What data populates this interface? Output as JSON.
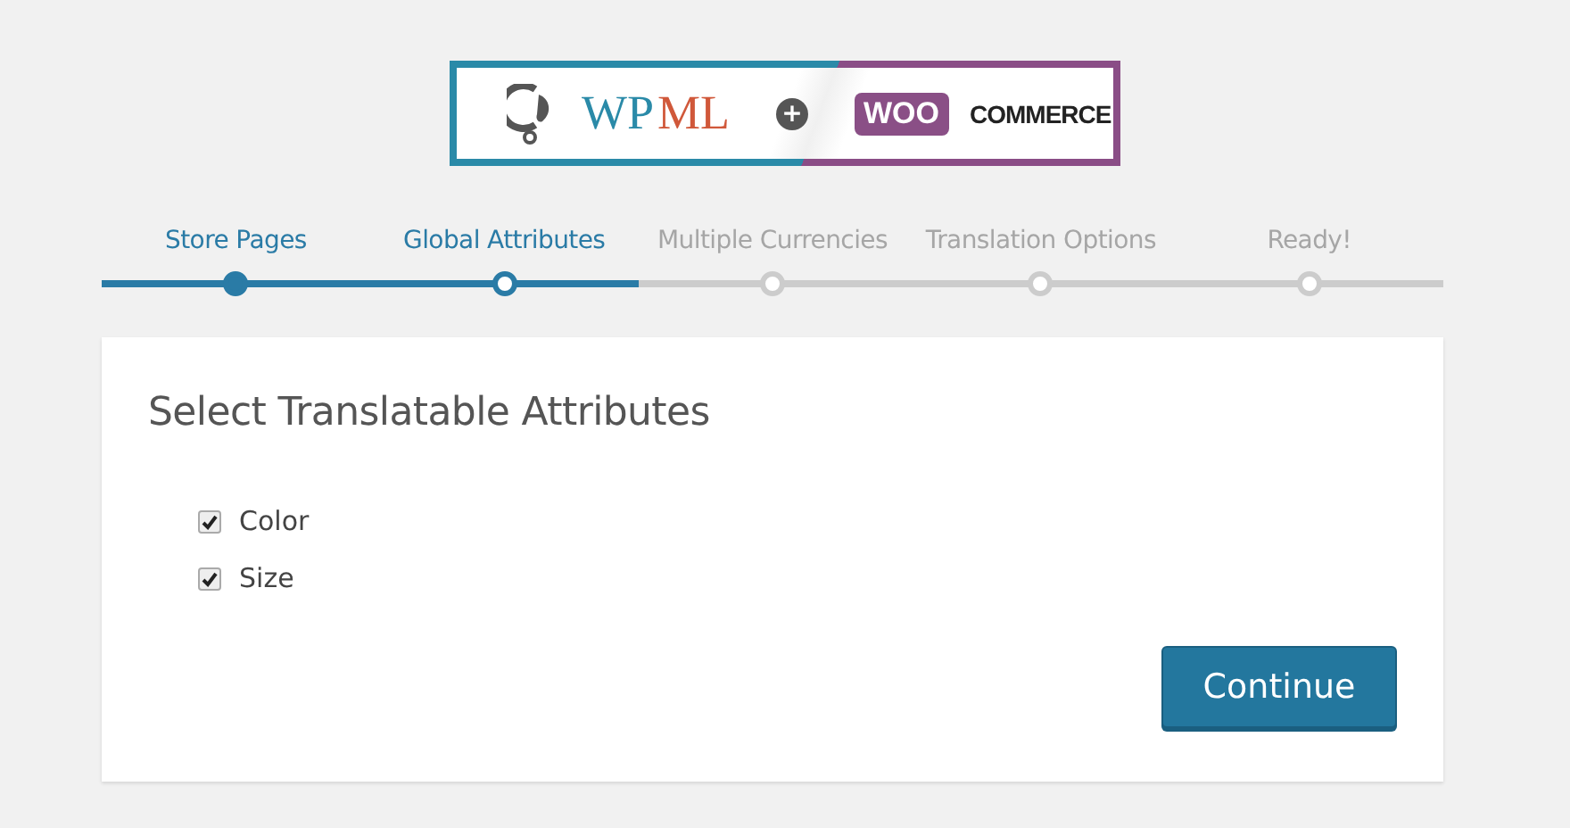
{
  "logo": {
    "left_text_1": "WP",
    "left_text_2": "ML",
    "plus": "+",
    "right_badge": "WOO",
    "right_text": "COMMERCE"
  },
  "steps": [
    {
      "label": "Store Pages",
      "completed": true,
      "selected": false
    },
    {
      "label": "Global Attributes",
      "completed": true,
      "selected": true
    },
    {
      "label": "Multiple Currencies",
      "completed": false,
      "selected": false
    },
    {
      "label": "Translation Options",
      "completed": false,
      "selected": false
    },
    {
      "label": "Ready!",
      "completed": false,
      "selected": false
    }
  ],
  "card": {
    "title": "Select Translatable Attributes",
    "attributes": [
      {
        "label": "Color",
        "checked": true
      },
      {
        "label": "Size",
        "checked": true
      }
    ],
    "button": "Continue"
  }
}
